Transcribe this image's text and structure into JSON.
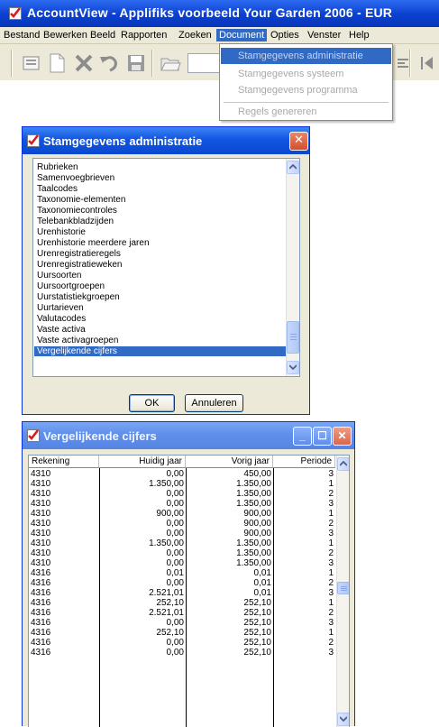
{
  "app": {
    "title": "AccountView - Applifiks voorbeeld Your Garden  2006 - EUR",
    "menu": [
      "Bestand",
      "Bewerken",
      "Beeld",
      "Rapporten",
      "Zoeken",
      "Document",
      "Opties",
      "Venster",
      "Help"
    ],
    "active_menu": "Document"
  },
  "document_menu": {
    "items": [
      "Stamgegevens administratie",
      "Stamgegevens systeem",
      "Stamgegevens programma",
      "Regels genereren"
    ],
    "highlighted": "Stamgegevens administratie"
  },
  "dialog": {
    "title": "Stamgegevens administratie",
    "items": [
      "Rubrieken",
      "Samenvoegbrieven",
      "Taalcodes",
      "Taxonomie-elementen",
      "Taxonomiecontroles",
      "Telebankbladzijden",
      "Urenhistorie",
      "Urenhistorie meerdere jaren",
      "Urenregistratieregels",
      "Urenregistratieweken",
      "Uursoorten",
      "Uursoortgroepen",
      "Uurstatistiekgroepen",
      "Uurtarieven",
      "Valutacodes",
      "Vaste activa",
      "Vaste activagroepen",
      "Vergelijkende cijfers"
    ],
    "selected": "Vergelijkende cijfers",
    "ok_label": "OK",
    "cancel_label": "Annuleren"
  },
  "comparison_window": {
    "title": "Vergelijkende cijfers",
    "columns": [
      "Rekening",
      "Huidig jaar",
      "Vorig jaar",
      "Periode"
    ],
    "rows": [
      [
        "4310",
        "0,00",
        "450,00",
        "3"
      ],
      [
        "4310",
        "1.350,00",
        "1.350,00",
        "1"
      ],
      [
        "4310",
        "0,00",
        "1.350,00",
        "2"
      ],
      [
        "4310",
        "0,00",
        "1.350,00",
        "3"
      ],
      [
        "4310",
        "900,00",
        "900,00",
        "1"
      ],
      [
        "4310",
        "0,00",
        "900,00",
        "2"
      ],
      [
        "4310",
        "0,00",
        "900,00",
        "3"
      ],
      [
        "4310",
        "1.350,00",
        "1.350,00",
        "1"
      ],
      [
        "4310",
        "0,00",
        "1.350,00",
        "2"
      ],
      [
        "4310",
        "0,00",
        "1.350,00",
        "3"
      ],
      [
        "4316",
        "0,01",
        "0,01",
        "1"
      ],
      [
        "4316",
        "0,00",
        "0,01",
        "2"
      ],
      [
        "4316",
        "2.521,01",
        "0,01",
        "3"
      ],
      [
        "4316",
        "252,10",
        "252,10",
        "1"
      ],
      [
        "4316",
        "2.521,01",
        "252,10",
        "2"
      ],
      [
        "4316",
        "0,00",
        "252,10",
        "3"
      ],
      [
        "4316",
        "252,10",
        "252,10",
        "1"
      ],
      [
        "4316",
        "0,00",
        "252,10",
        "2"
      ],
      [
        "4316",
        "0,00",
        "252,10",
        "3"
      ]
    ]
  },
  "icons": [
    "check-icon",
    "list-icon",
    "new-doc-icon",
    "delete-icon",
    "undo-icon",
    "save-icon",
    "folder-icon",
    "first-record-icon",
    "scroll-up-icon",
    "scroll-down-icon",
    "close-icon",
    "minimize-icon",
    "maximize-icon"
  ]
}
